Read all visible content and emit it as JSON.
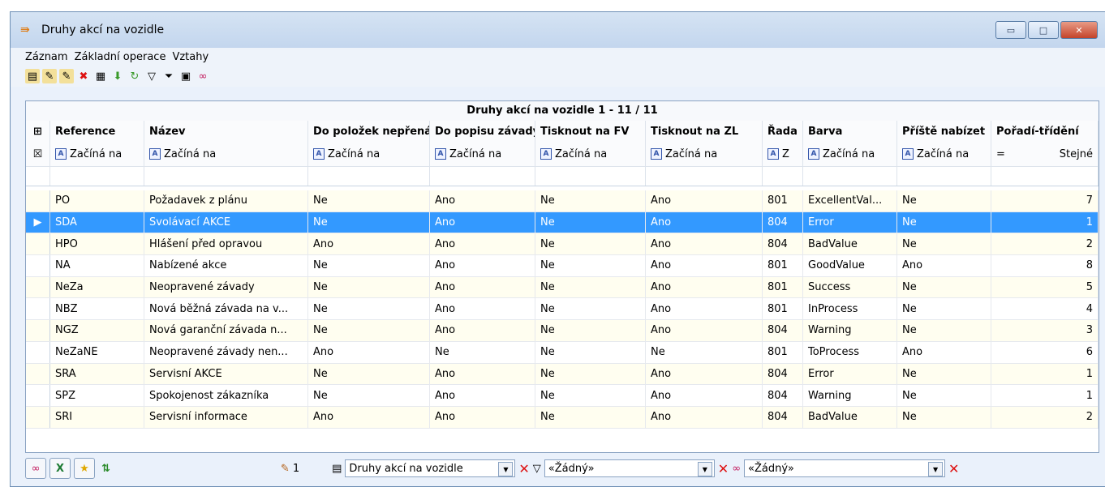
{
  "window": {
    "title": "Druhy akcí na vozidle",
    "buttons": {
      "minimize": "▭",
      "maximize": "□",
      "close": "✕"
    }
  },
  "menu": [
    "Záznam",
    "Základní operace",
    "Vztahy"
  ],
  "toolbar_icons": [
    "new-record-icon",
    "edit-record-icon",
    "copy-record-icon",
    "delete-record-icon",
    "print-icon",
    "import-icon",
    "refresh-icon",
    "filter-icon",
    "clear-filter-icon",
    "form-view-icon",
    "relations-icon"
  ],
  "grid": {
    "caption": "Druhy akcí na vozidle  1 - 11 / 11",
    "columns": [
      "Reference",
      "Název",
      "Do položek nepřenášet",
      "Do popisu závady",
      "Tisknout na FV",
      "Tisknout na ZL",
      "Řada",
      "Barva",
      "Příště nabízet",
      "Pořadí-třídění"
    ],
    "filters": [
      "Začíná na",
      "Začíná na",
      "Začíná na",
      "Začíná na",
      "Začíná na",
      "Začíná na",
      "Z",
      "Začíná na",
      "Začíná na",
      "Stejné"
    ],
    "filter_last_op": "=",
    "selected_index": 1,
    "row_marker": "▶",
    "rows": [
      [
        "PO",
        "Požadavek z plánu",
        "Ne",
        "Ano",
        "Ne",
        "Ano",
        "801",
        "ExcellentVal...",
        "Ne",
        "7"
      ],
      [
        "SDA",
        "Svolávací AKCE",
        "Ne",
        "Ano",
        "Ne",
        "Ano",
        "804",
        "Error",
        "Ne",
        "1"
      ],
      [
        "HPO",
        "Hlášení před opravou",
        "Ano",
        "Ano",
        "Ne",
        "Ano",
        "804",
        "BadValue",
        "Ne",
        "2"
      ],
      [
        "NA",
        "Nabízené akce",
        "Ne",
        "Ano",
        "Ne",
        "Ano",
        "801",
        "GoodValue",
        "Ano",
        "8"
      ],
      [
        "NeZa",
        "Neopravené závady",
        "Ne",
        "Ano",
        "Ne",
        "Ano",
        "801",
        "Success",
        "Ne",
        "5"
      ],
      [
        "NBZ",
        "Nová běžná závada na v...",
        "Ne",
        "Ano",
        "Ne",
        "Ano",
        "801",
        "InProcess",
        "Ne",
        "4"
      ],
      [
        "NGZ",
        "Nová garanční závada n...",
        "Ne",
        "Ano",
        "Ne",
        "Ano",
        "804",
        "Warning",
        "Ne",
        "3"
      ],
      [
        "NeZaNE",
        "Neopravené závady nen...",
        "Ano",
        "Ne",
        "Ne",
        "Ne",
        "801",
        "ToProcess",
        "Ano",
        "6"
      ],
      [
        "SRA",
        "Servisní AKCE",
        "Ne",
        "Ano",
        "Ne",
        "Ano",
        "804",
        "Error",
        "Ne",
        "1"
      ],
      [
        "SPZ",
        "Spokojenost zákazníka",
        "Ne",
        "Ano",
        "Ne",
        "Ano",
        "804",
        "Warning",
        "Ne",
        "1"
      ],
      [
        "SRI",
        "Servisní informace",
        "Ano",
        "Ano",
        "Ne",
        "Ano",
        "804",
        "BadValue",
        "Ne",
        "2"
      ]
    ]
  },
  "statusbar": {
    "count": "1",
    "view_combo": "Druhy akcí na vozidle",
    "filter_combo": "«Žádný»",
    "relation_combo": "«Žádný»"
  },
  "colors": {
    "selection": "#3399ff",
    "alt_row": "#fffef0",
    "title_bg": "#c3d6ee"
  }
}
